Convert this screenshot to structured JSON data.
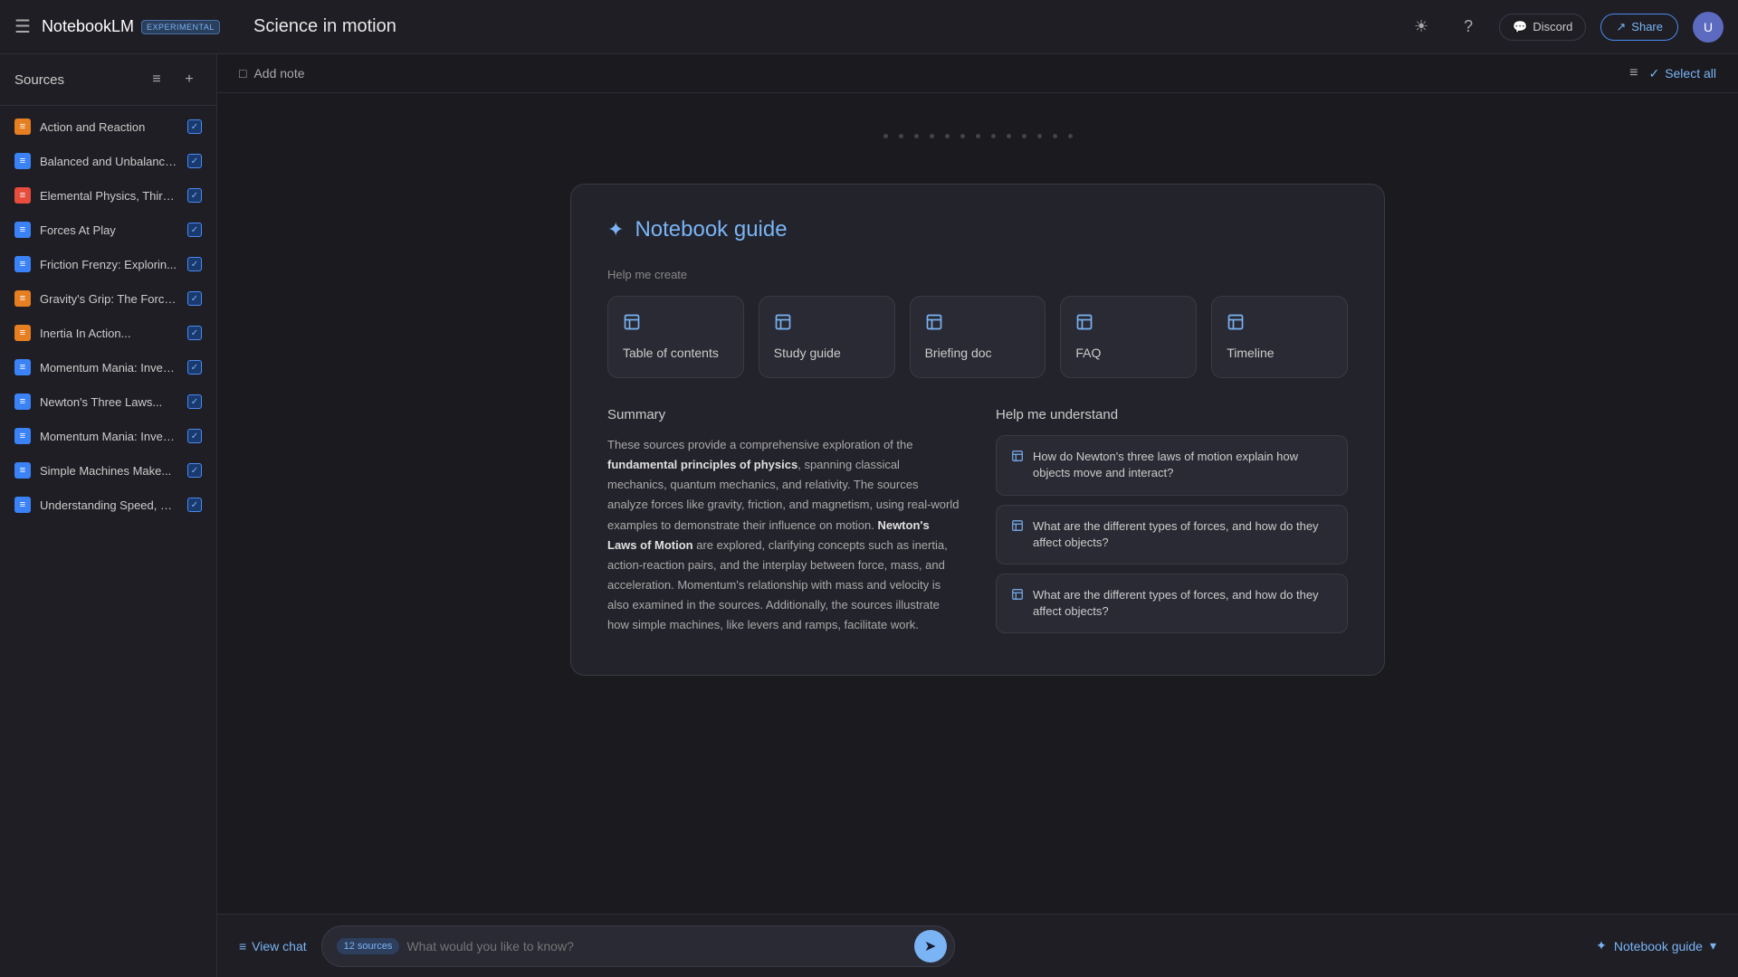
{
  "app": {
    "brand": "NotebookLM",
    "badge": "EXPERIMENTAL",
    "notebook_title": "Science in motion"
  },
  "navbar": {
    "discord_label": "Discord",
    "share_label": "Share",
    "avatar_initials": "U"
  },
  "sidebar": {
    "title": "Sources",
    "filter_icon": "≡",
    "add_icon": "+",
    "sources": [
      {
        "name": "Action and Reaction",
        "type": "orange",
        "checked": true
      },
      {
        "name": "Balanced and Unbalance...",
        "type": "blue",
        "checked": true
      },
      {
        "name": "Elemental Physics, Third...",
        "type": "red",
        "checked": true
      },
      {
        "name": "Forces At Play",
        "type": "blue",
        "checked": true
      },
      {
        "name": "Friction Frenzy: Explorin...",
        "type": "blue",
        "checked": true
      },
      {
        "name": "Gravity's Grip: The Force...",
        "type": "orange",
        "checked": true
      },
      {
        "name": "Inertia In Action...",
        "type": "orange",
        "checked": true
      },
      {
        "name": "Momentum Mania: Inves...",
        "type": "blue",
        "checked": true
      },
      {
        "name": "Newton's Three Laws...",
        "type": "blue",
        "checked": true
      },
      {
        "name": "Momentum Mania: Inves...",
        "type": "blue",
        "checked": true
      },
      {
        "name": "Simple Machines Make...",
        "type": "blue",
        "checked": true
      },
      {
        "name": "Understanding Speed, Ve...",
        "type": "blue",
        "checked": true
      }
    ]
  },
  "toolbar": {
    "add_note_label": "Add note",
    "select_all_label": "Select all"
  },
  "guide": {
    "title": "Notebook guide",
    "help_create_label": "Help me create",
    "cards": [
      {
        "label": "Table of contents",
        "icon": "📋"
      },
      {
        "label": "Study guide",
        "icon": "📋"
      },
      {
        "label": "Briefing doc",
        "icon": "📋"
      },
      {
        "label": "FAQ",
        "icon": "📋"
      },
      {
        "label": "Timeline",
        "icon": "📋"
      }
    ],
    "summary": {
      "title": "Summary",
      "text_parts": [
        {
          "text": "These sources provide a comprehensive exploration of the ",
          "bold": false
        },
        {
          "text": "fundamental principles of physics",
          "bold": true
        },
        {
          "text": ", spanning classical mechanics, quantum mechanics, and relativity. The sources analyze forces like gravity, friction, and magnetism, using real-world examples to demonstrate their influence on motion. ",
          "bold": false
        },
        {
          "text": "Newton's Laws of Motion",
          "bold": true
        },
        {
          "text": " are explored, clarifying concepts such as inertia, action-reaction pairs, and the interplay between force, mass, and acceleration. Momentum's relationship with mass and velocity is also examined in the sources. Additionally, the sources illustrate how simple machines, like levers and ramps, facilitate work.",
          "bold": false
        }
      ]
    },
    "understand": {
      "title": "Help me understand",
      "questions": [
        "How do Newton's three laws of motion explain how objects move and interact?",
        "What are the different types of forces, and how do they affect objects?",
        "What are the different types of forces, and how do they affect objects?"
      ]
    }
  },
  "bottom_bar": {
    "view_chat_label": "View chat",
    "sources_badge": "12 sources",
    "chat_placeholder": "What would you like to know?",
    "notebook_guide_label": "Notebook guide"
  },
  "dots": [
    1,
    2,
    3,
    4,
    5,
    6,
    7,
    8,
    9,
    10,
    11,
    12,
    13
  ]
}
